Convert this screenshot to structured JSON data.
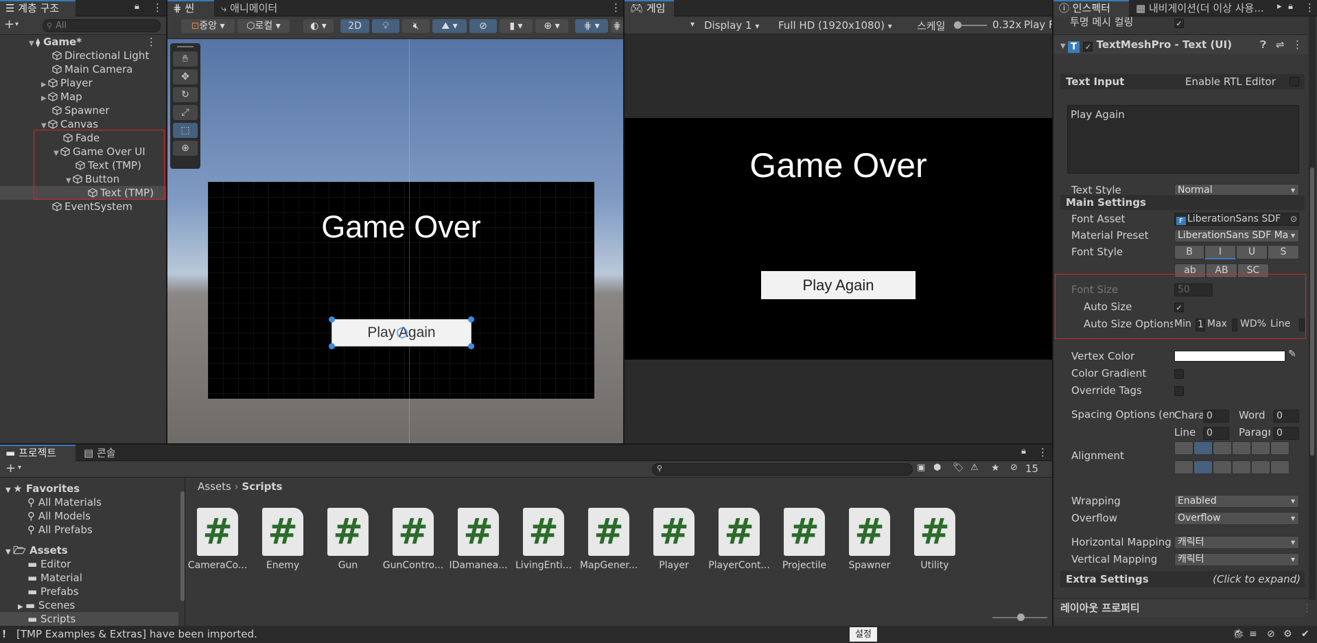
{
  "hierarchy": {
    "tab": "계층 구조",
    "search_placeholder": "All",
    "scene": "Game*",
    "items": [
      {
        "label": "Directional Light"
      },
      {
        "label": "Main Camera"
      },
      {
        "label": "Player"
      },
      {
        "label": "Map"
      },
      {
        "label": "Spawner"
      },
      {
        "label": "Canvas"
      },
      {
        "label": "Fade"
      },
      {
        "label": "Game Over UI"
      },
      {
        "label": "Text (TMP)"
      },
      {
        "label": "Button"
      },
      {
        "label": "Text (TMP)"
      },
      {
        "label": "EventSystem"
      }
    ]
  },
  "scene_view": {
    "tab_scene": "씬",
    "tab_animator": "애니메이터",
    "pivot": "중앙",
    "space": "로컬",
    "mode_2d": "2D",
    "title": "Game Over",
    "button": "Play Again"
  },
  "game_view": {
    "tab": "게임",
    "display": "Display 1",
    "resolution": "Full HD (1920x1080)",
    "scale_label": "스케일",
    "scale_value": "0.32x",
    "play_focus": "Play F",
    "title": "Game Over",
    "button": "Play Again"
  },
  "inspector": {
    "tab": "인스펙터",
    "tab_nav": "내비게이션(더 이상 사용...",
    "transparent_culling": "투명 메시 컬링",
    "component": "TextMeshPro - Text (UI)",
    "text_input": "Text Input",
    "enable_rtl": "Enable RTL Editor",
    "text_value": "Play Again",
    "text_style_label": "Text Style",
    "text_style": "Normal",
    "main_settings": "Main Settings",
    "font_asset_label": "Font Asset",
    "font_asset": "LiberationSans SDF",
    "material_preset_label": "Material Preset",
    "material_preset": "LiberationSans SDF Ma",
    "font_style_label": "Font Style",
    "style_btns": [
      "B",
      "I",
      "U",
      "S",
      "ab",
      "AB",
      "SC"
    ],
    "font_size_label": "Font Size",
    "font_size": "50",
    "auto_size_label": "Auto Size",
    "auto_size_options_label": "Auto Size Options",
    "min_label": "Min",
    "min_value": "1",
    "max_label": "Max",
    "wd_label": "WD%",
    "line_label": "Line",
    "vertex_color_label": "Vertex Color",
    "vertex_color": "#ffffff",
    "color_gradient_label": "Color Gradient",
    "override_tags_label": "Override Tags",
    "spacing_label": "Spacing Options (em)",
    "char_label": "Charac",
    "char_value": "0",
    "word_label": "Word",
    "word_value": "0",
    "spacing_line_label": "Line",
    "spacing_line_value": "0",
    "para_label": "Paragra",
    "para_value": "0",
    "alignment_label": "Alignment",
    "wrapping_label": "Wrapping",
    "wrapping": "Enabled",
    "overflow_label": "Overflow",
    "overflow": "Overflow",
    "h_mapping_label": "Horizontal Mapping",
    "h_mapping": "캐릭터",
    "v_mapping_label": "Vertical Mapping",
    "v_mapping": "캐릭터",
    "extra_settings": "Extra Settings",
    "click_expand": "(Click to expand)",
    "layout_props": "레이아웃 프로퍼티"
  },
  "project": {
    "tab_project": "프로젝트",
    "tab_console": "콘솔",
    "hidden_count": "15",
    "favorites": "Favorites",
    "fav_items": [
      "All Materials",
      "All Models",
      "All Prefabs"
    ],
    "assets": "Assets",
    "folders": [
      "Editor",
      "Material",
      "Prefabs",
      "Scenes",
      "Scripts"
    ],
    "breadcrumb_root": "Assets",
    "breadcrumb_leaf": "Scripts",
    "scripts": [
      "CameraCo...",
      "Enemy",
      "Gun",
      "GunContro...",
      "IDamanea...",
      "LivingEnti...",
      "MapGener...",
      "Player",
      "PlayerCont...",
      "Projectile",
      "Spawner",
      "Utility"
    ]
  },
  "status": {
    "message": "[TMP Examples & Extras] have been imported.",
    "settings": "설정"
  },
  "colors": {
    "accent": "#3a79bb",
    "highlight_red": "#d9252b",
    "script_green": "#2b6b2b"
  }
}
